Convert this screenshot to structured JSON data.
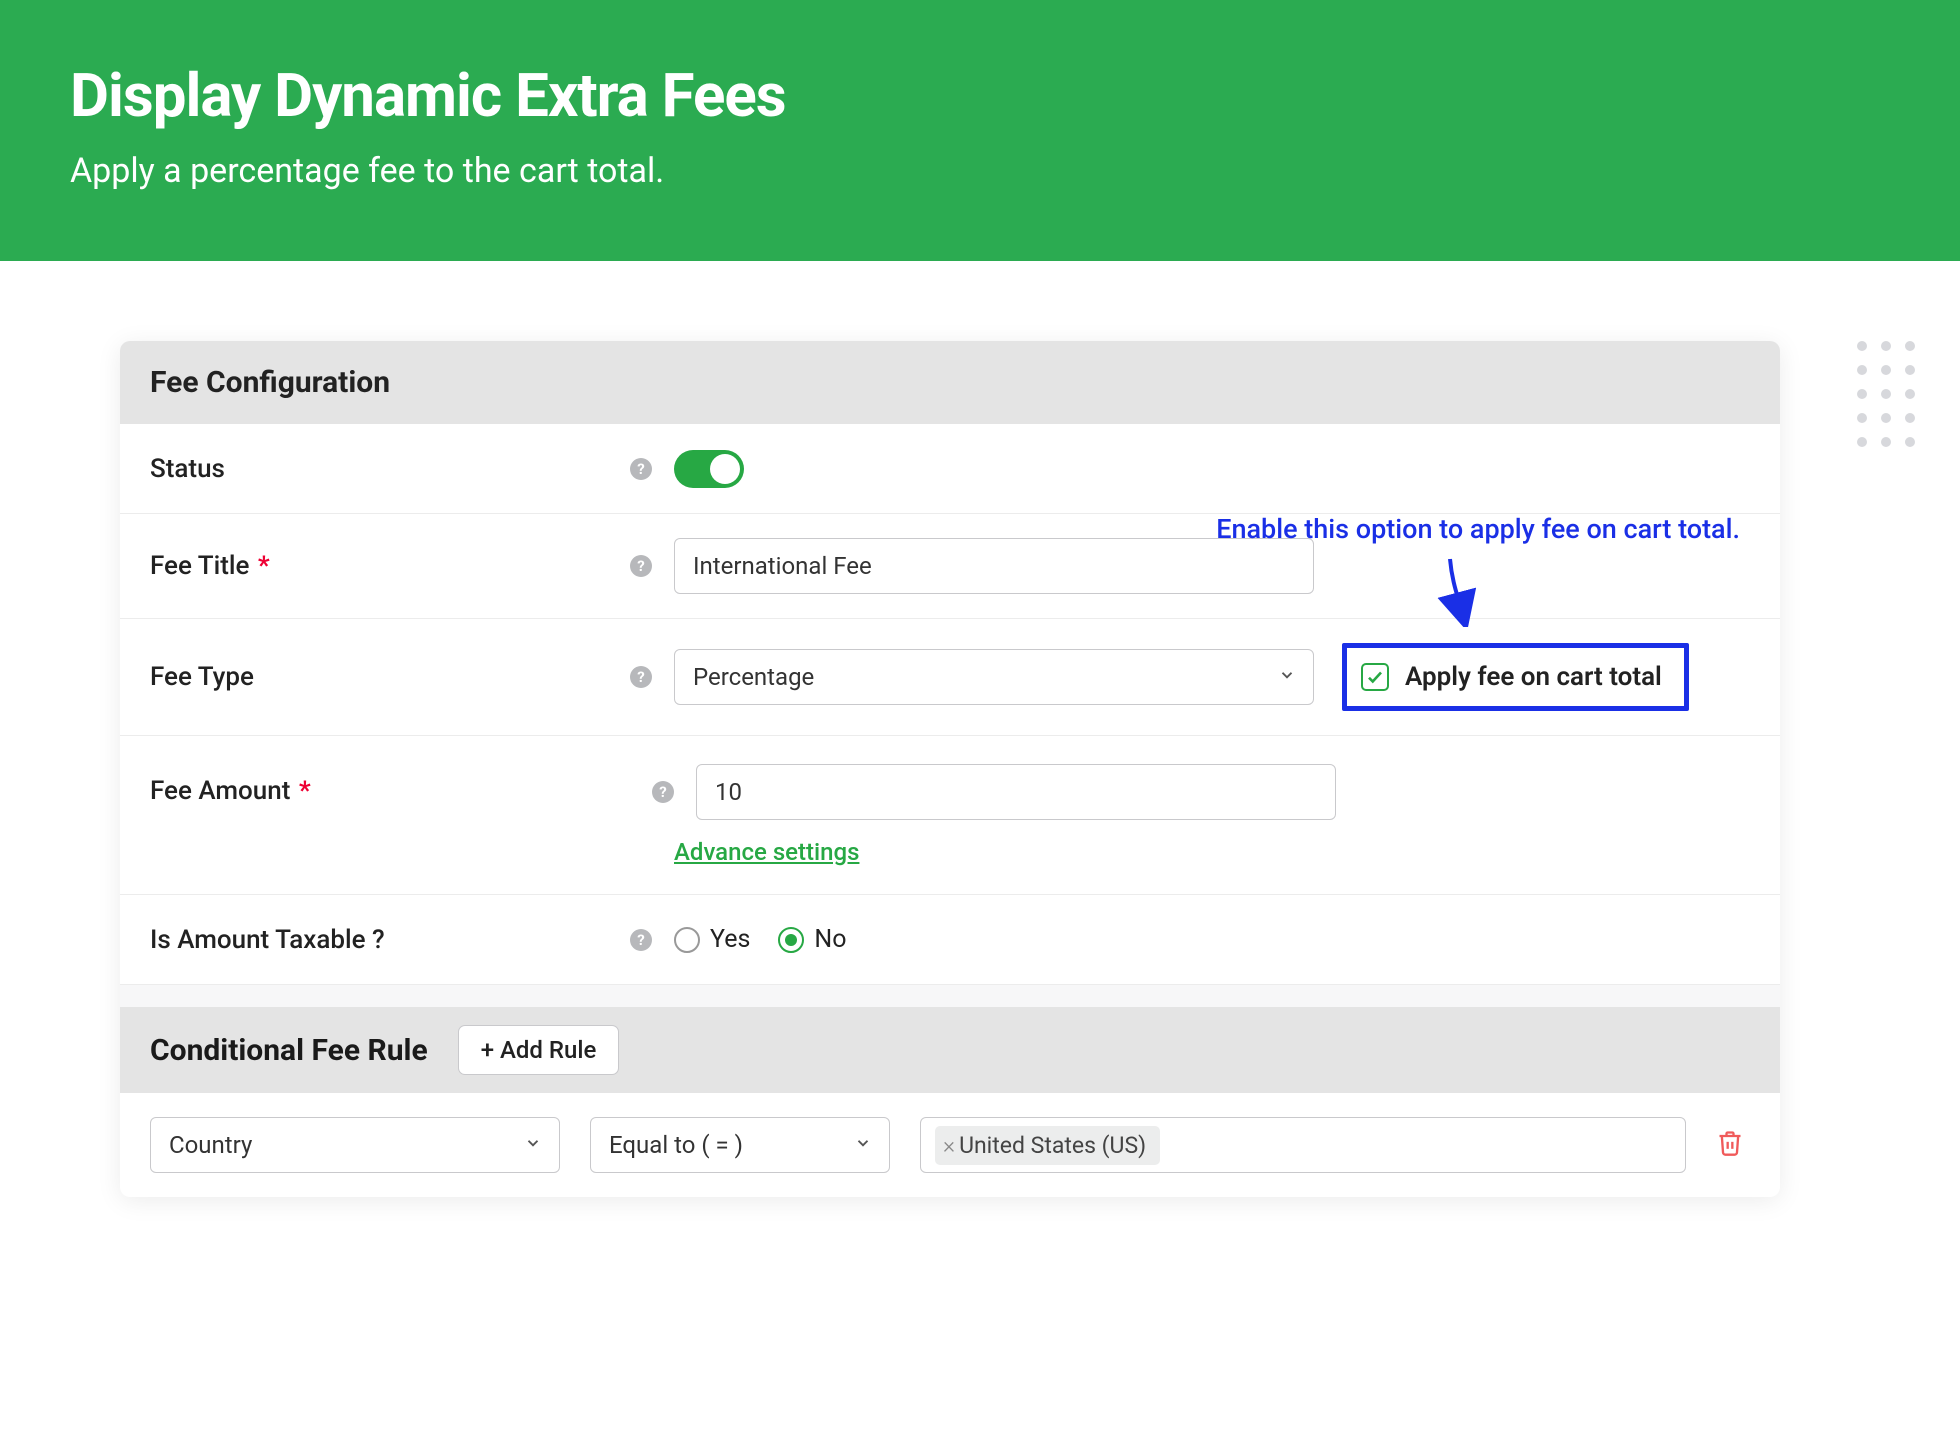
{
  "header": {
    "title": "Display Dynamic Extra Fees",
    "subtitle": "Apply a percentage fee to the cart total."
  },
  "section1": {
    "title": "Fee Configuration",
    "status_label": "Status",
    "fee_title_label": "Fee Title",
    "fee_title_value": "International Fee",
    "fee_type_label": "Fee Type",
    "fee_type_value": "Percentage",
    "apply_cart_label": "Apply fee on cart total",
    "callout_text": "Enable this option to apply fee on cart total.",
    "fee_amount_label": "Fee Amount",
    "fee_amount_value": "10",
    "advance_link": "Advance settings",
    "taxable_label": "Is Amount Taxable ?",
    "taxable_yes": "Yes",
    "taxable_no": "No"
  },
  "section2": {
    "title": "Conditional Fee Rule",
    "add_rule_label": "+ Add Rule",
    "rule_field": "Country",
    "rule_operator": "Equal to ( = )",
    "rule_value": "United States (US)"
  },
  "help_glyph": "?"
}
